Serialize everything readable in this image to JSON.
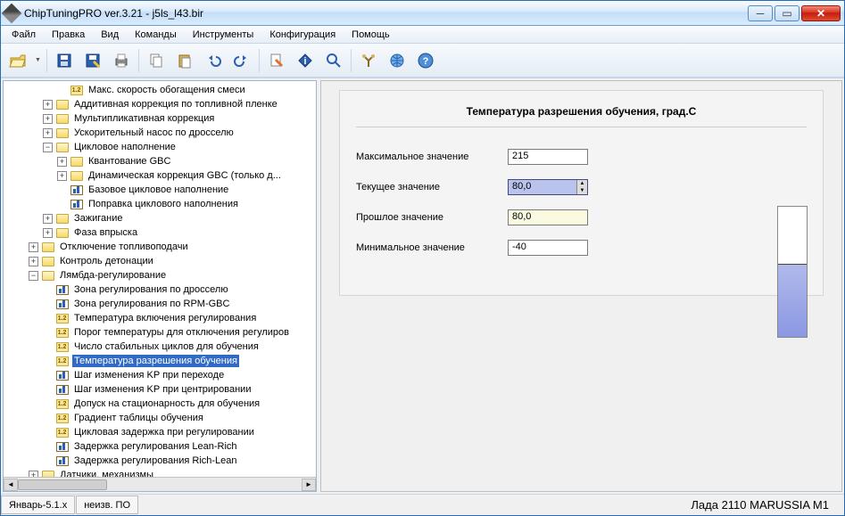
{
  "window": {
    "title": "ChipTuningPRO ver.3.21 - j5ls_l43.bir"
  },
  "menu": [
    "Файл",
    "Правка",
    "Вид",
    "Команды",
    "Инструменты",
    "Конфигурация",
    "Помощь"
  ],
  "toolbar_icons": [
    "open",
    "save",
    "saveas",
    "print",
    "copy",
    "paste",
    "undo",
    "redo",
    "edit",
    "info",
    "find",
    "tools",
    "net",
    "help"
  ],
  "tree": [
    {
      "indent": 60,
      "exp": "none",
      "icon": "12",
      "label": "Макс. скорость обогащения смеси"
    },
    {
      "indent": 44,
      "exp": "plus",
      "icon": "folder",
      "label": "Аддитивная коррекция по топливной пленке"
    },
    {
      "indent": 44,
      "exp": "plus",
      "icon": "folder",
      "label": "Мультипликативная коррекция"
    },
    {
      "indent": 44,
      "exp": "plus",
      "icon": "folder",
      "label": "Ускорительный насос по дросселю"
    },
    {
      "indent": 44,
      "exp": "minus",
      "icon": "folder-open",
      "label": "Цикловое наполнение"
    },
    {
      "indent": 60,
      "exp": "plus",
      "icon": "folder",
      "label": "Квантование GBC"
    },
    {
      "indent": 60,
      "exp": "plus",
      "icon": "folder",
      "label": "Динамическая коррекция GBC (только д..."
    },
    {
      "indent": 60,
      "exp": "none",
      "icon": "bars",
      "label": "Базовое цикловое наполнение"
    },
    {
      "indent": 60,
      "exp": "none",
      "icon": "bars",
      "label": "Поправка циклового наполнения"
    },
    {
      "indent": 44,
      "exp": "plus",
      "icon": "folder",
      "label": "Зажигание"
    },
    {
      "indent": 44,
      "exp": "plus",
      "icon": "folder",
      "label": "Фаза впрыска"
    },
    {
      "indent": 28,
      "exp": "plus",
      "icon": "folder",
      "label": "Отключение топливоподачи"
    },
    {
      "indent": 28,
      "exp": "plus",
      "icon": "folder",
      "label": "Контроль детонации"
    },
    {
      "indent": 28,
      "exp": "minus",
      "icon": "folder-open",
      "label": "Лямбда-регулирование"
    },
    {
      "indent": 44,
      "exp": "none",
      "icon": "bars",
      "label": "Зона регулирования по дросселю"
    },
    {
      "indent": 44,
      "exp": "none",
      "icon": "bars",
      "label": "Зона регулирования по RPM-GBC"
    },
    {
      "indent": 44,
      "exp": "none",
      "icon": "12",
      "label": "Температура включения регулирования"
    },
    {
      "indent": 44,
      "exp": "none",
      "icon": "12",
      "label": "Порог температуры для отключения регулиров"
    },
    {
      "indent": 44,
      "exp": "none",
      "icon": "12",
      "label": "Число стабильных циклов для обучения"
    },
    {
      "indent": 44,
      "exp": "none",
      "icon": "12",
      "label": "Температура разрешения обучения",
      "selected": true
    },
    {
      "indent": 44,
      "exp": "none",
      "icon": "bars",
      "label": "Шаг изменения KP при переходе"
    },
    {
      "indent": 44,
      "exp": "none",
      "icon": "bars",
      "label": "Шаг изменения KP при центрировании"
    },
    {
      "indent": 44,
      "exp": "none",
      "icon": "12",
      "label": "Допуск на стационарность для обучения"
    },
    {
      "indent": 44,
      "exp": "none",
      "icon": "12",
      "label": "Градиент таблицы обучения"
    },
    {
      "indent": 44,
      "exp": "none",
      "icon": "12",
      "label": "Цикловая задержка при регулировании"
    },
    {
      "indent": 44,
      "exp": "none",
      "icon": "bars",
      "label": "Задержка регулирования Lean-Rich"
    },
    {
      "indent": 44,
      "exp": "none",
      "icon": "bars",
      "label": "Задержка регулирования Rich-Lean"
    },
    {
      "indent": 28,
      "exp": "plus",
      "icon": "folder",
      "label": "Датчики, механизмы"
    }
  ],
  "panel": {
    "title": "Температура разрешения обучения, град.С",
    "rows": {
      "max_label": "Максимальное значение",
      "max_value": "215",
      "cur_label": "Текущее значение",
      "cur_value": "80,0",
      "prev_label": "Прошлое значение",
      "prev_value": "80,0",
      "min_label": "Минимальное значение",
      "min_value": "-40"
    }
  },
  "status": {
    "left1": "Январь-5.1.x",
    "left2": "неизв. ПО",
    "right": "Лада 2110 MARUSSIA M1"
  }
}
